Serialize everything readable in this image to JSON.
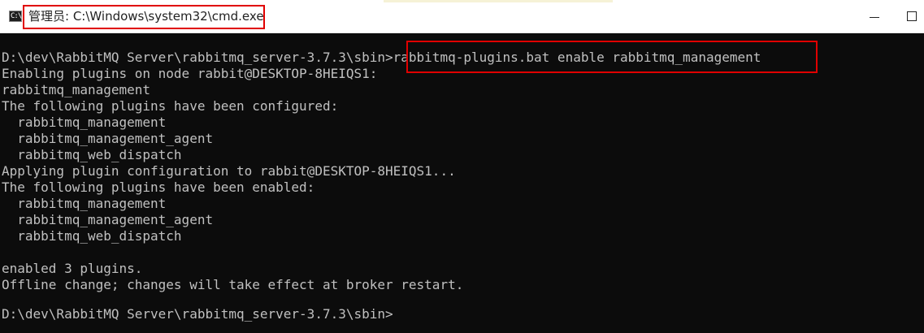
{
  "window": {
    "title": "管理员: C:\\Windows\\system32\\cmd.exe",
    "icon_label": "C:\\",
    "icon_name": "cmd-icon"
  },
  "console": {
    "lines": [
      "",
      "D:\\dev\\RabbitMQ Server\\rabbitmq_server-3.7.3\\sbin>rabbitmq-plugins.bat enable rabbitmq_management",
      "Enabling plugins on node rabbit@DESKTOP-8HEIQS1:",
      "rabbitmq_management",
      "The following plugins have been configured:",
      "  rabbitmq_management",
      "  rabbitmq_management_agent",
      "  rabbitmq_web_dispatch",
      "Applying plugin configuration to rabbit@DESKTOP-8HEIQS1...",
      "The following plugins have been enabled:",
      "  rabbitmq_management",
      "  rabbitmq_management_agent",
      "  rabbitmq_web_dispatch",
      "",
      "enabled 3 plugins.",
      "Offline change; changes will take effect at broker restart.",
      "",
      "D:\\dev\\RabbitMQ Server\\rabbitmq_server-3.7.3\\sbin>"
    ]
  },
  "colors": {
    "console_bg": "#0c0c0c",
    "console_text": "#c0c0c0",
    "highlight": "#e00000"
  }
}
